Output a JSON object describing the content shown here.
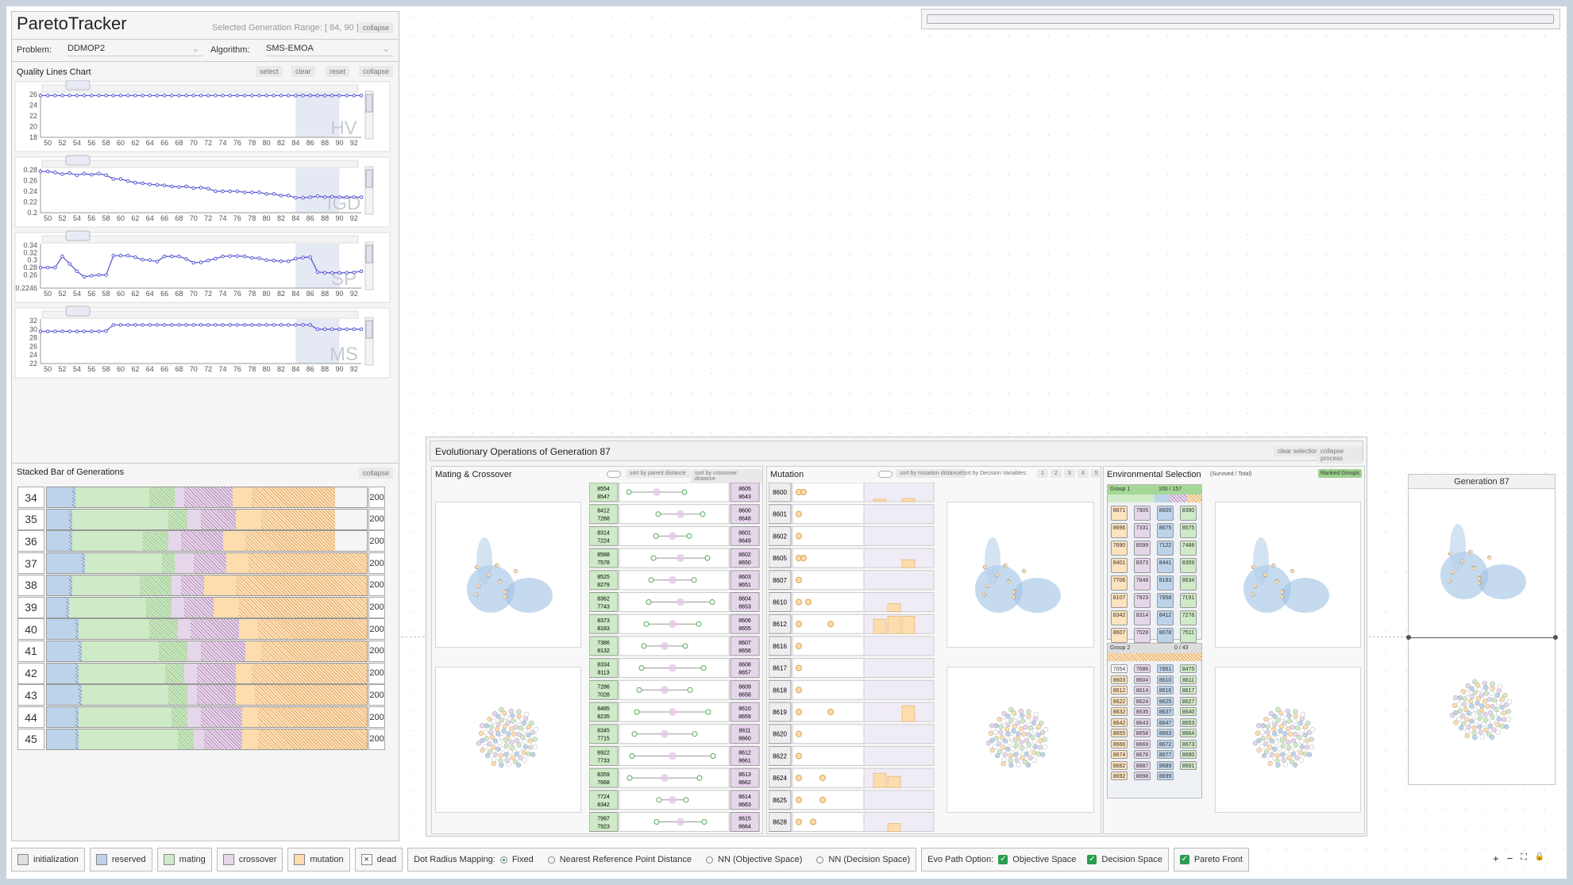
{
  "app": {
    "title": "ParetoTracker",
    "selected_range": "Selected Generation Range: [ 84, 90 ]",
    "collapse": "collapse"
  },
  "problem": {
    "label": "Problem:",
    "value": "DDMOP2"
  },
  "algorithm": {
    "label": "Algorithm:",
    "value": "SMS-EMOA"
  },
  "quality": {
    "title": "Quality Lines Chart",
    "select": "select",
    "clear": "clear",
    "reset": "reset",
    "collapse": "collapse",
    "x_ticks": [
      "50",
      "52",
      "54",
      "56",
      "58",
      "60",
      "62",
      "64",
      "66",
      "68",
      "70",
      "72",
      "74",
      "76",
      "78",
      "80",
      "82",
      "84",
      "86",
      "88",
      "90",
      "92"
    ],
    "charts": [
      {
        "name": "HV",
        "y_ticks": [
          "26",
          "24",
          "22",
          "20",
          "18"
        ]
      },
      {
        "name": "IGD",
        "y_ticks": [
          "0.28",
          "0.26",
          "0.24",
          "0.22",
          "0.2"
        ]
      },
      {
        "name": "SP",
        "y_ticks": [
          "0.34",
          "0.32",
          "0.3",
          "0.28",
          "0.26",
          "0.2246"
        ]
      },
      {
        "name": "MS",
        "y_ticks": [
          "32",
          "30",
          "28",
          "26",
          "24",
          "22"
        ]
      }
    ]
  },
  "chart_data": [
    {
      "type": "line",
      "title": "HV",
      "x": [
        49,
        50,
        51,
        52,
        53,
        54,
        55,
        56,
        57,
        58,
        59,
        60,
        61,
        62,
        63,
        64,
        65,
        66,
        67,
        68,
        69,
        70,
        71,
        72,
        73,
        74,
        75,
        76,
        77,
        78,
        79,
        80,
        81,
        82,
        83,
        84,
        85,
        86,
        87,
        88,
        89,
        90,
        91,
        92,
        93
      ],
      "y": [
        25.8,
        25.8,
        25.8,
        25.8,
        25.8,
        25.8,
        25.8,
        25.8,
        25.8,
        25.8,
        25.8,
        25.8,
        25.8,
        25.8,
        25.8,
        25.8,
        25.8,
        25.8,
        25.8,
        25.8,
        25.8,
        25.8,
        25.8,
        25.8,
        25.8,
        25.8,
        25.8,
        25.8,
        25.8,
        25.8,
        25.8,
        25.8,
        25.8,
        25.8,
        25.8,
        25.8,
        25.8,
        25.8,
        25.8,
        25.8,
        25.8,
        25.8,
        25.8,
        25.8,
        25.8
      ],
      "ylim": [
        18,
        26
      ]
    },
    {
      "type": "line",
      "title": "IGD",
      "x": [
        49,
        50,
        51,
        52,
        53,
        54,
        55,
        56,
        57,
        58,
        59,
        60,
        61,
        62,
        63,
        64,
        65,
        66,
        67,
        68,
        69,
        70,
        71,
        72,
        73,
        74,
        75,
        76,
        77,
        78,
        79,
        80,
        81,
        82,
        83,
        84,
        85,
        86,
        87,
        88,
        89,
        90,
        91,
        92,
        93
      ],
      "y": [
        0.277,
        0.277,
        0.275,
        0.272,
        0.274,
        0.27,
        0.273,
        0.271,
        0.273,
        0.27,
        0.263,
        0.263,
        0.259,
        0.256,
        0.255,
        0.253,
        0.252,
        0.251,
        0.249,
        0.248,
        0.249,
        0.246,
        0.247,
        0.245,
        0.24,
        0.24,
        0.24,
        0.24,
        0.238,
        0.238,
        0.238,
        0.235,
        0.235,
        0.232,
        0.232,
        0.228,
        0.228,
        0.229,
        0.231,
        0.229,
        0.23,
        0.229,
        0.229,
        0.229,
        0.229
      ],
      "ylim": [
        0.2,
        0.28
      ]
    },
    {
      "type": "line",
      "title": "SP",
      "x": [
        49,
        50,
        51,
        52,
        53,
        54,
        55,
        56,
        57,
        58,
        59,
        60,
        61,
        62,
        63,
        64,
        65,
        66,
        67,
        68,
        69,
        70,
        71,
        72,
        73,
        74,
        75,
        76,
        77,
        78,
        79,
        80,
        81,
        82,
        83,
        84,
        85,
        86,
        87,
        88,
        89,
        90,
        91,
        92,
        93
      ],
      "y": [
        0.28,
        0.28,
        0.28,
        0.31,
        0.29,
        0.27,
        0.255,
        0.258,
        0.26,
        0.26,
        0.312,
        0.312,
        0.312,
        0.308,
        0.301,
        0.3,
        0.296,
        0.31,
        0.31,
        0.31,
        0.303,
        0.293,
        0.294,
        0.299,
        0.304,
        0.31,
        0.311,
        0.311,
        0.31,
        0.306,
        0.305,
        0.3,
        0.299,
        0.297,
        0.297,
        0.304,
        0.307,
        0.308,
        0.268,
        0.266,
        0.266,
        0.266,
        0.266,
        0.267,
        0.27
      ],
      "ylim": [
        0.2246,
        0.34
      ]
    },
    {
      "type": "line",
      "title": "MS",
      "x": [
        49,
        50,
        51,
        52,
        53,
        54,
        55,
        56,
        57,
        58,
        59,
        60,
        61,
        62,
        63,
        64,
        65,
        66,
        67,
        68,
        69,
        70,
        71,
        72,
        73,
        74,
        75,
        76,
        77,
        78,
        79,
        80,
        81,
        82,
        83,
        84,
        85,
        86,
        87,
        88,
        89,
        90,
        91,
        92,
        93
      ],
      "y": [
        29.5,
        29.5,
        29.5,
        29.5,
        29.5,
        29.5,
        29.5,
        29.5,
        29.5,
        29.6,
        31,
        31,
        31,
        31,
        31,
        31,
        31,
        31,
        31,
        31,
        31,
        31,
        31,
        31,
        31,
        31,
        31,
        31,
        31,
        31,
        31,
        31,
        31,
        31,
        31,
        31,
        31,
        31,
        30,
        30,
        30,
        30,
        30,
        30,
        30
      ],
      "ylim": [
        22,
        32
      ]
    }
  ],
  "stacked": {
    "title": "Stacked Bar of Generations",
    "collapse": "collapse",
    "rows": [
      {
        "gen": "34",
        "total": "200",
        "segs": [
          [
            0.08,
            "b"
          ],
          [
            0.01,
            "hb"
          ],
          [
            0.23,
            "g"
          ],
          [
            0.08,
            "hg"
          ],
          [
            0.03,
            "p"
          ],
          [
            0.15,
            "hp"
          ],
          [
            0.06,
            "o"
          ],
          [
            0.26,
            "ho"
          ]
        ]
      },
      {
        "gen": "35",
        "total": "200",
        "segs": [
          [
            0.07,
            "b"
          ],
          [
            0.01,
            "hb"
          ],
          [
            0.3,
            "g"
          ],
          [
            0.06,
            "hg"
          ],
          [
            0.04,
            "p"
          ],
          [
            0.11,
            "hp"
          ],
          [
            0.08,
            "o"
          ],
          [
            0.23,
            "ho"
          ]
        ]
      },
      {
        "gen": "36",
        "total": "200",
        "segs": [
          [
            0.07,
            "b"
          ],
          [
            0.01,
            "hb"
          ],
          [
            0.22,
            "g"
          ],
          [
            0.08,
            "hg"
          ],
          [
            0.04,
            "p"
          ],
          [
            0.13,
            "hp"
          ],
          [
            0.07,
            "o"
          ],
          [
            0.28,
            "ho"
          ]
        ]
      },
      {
        "gen": "37",
        "total": "200",
        "segs": [
          [
            0.11,
            "b"
          ],
          [
            0.01,
            "hb"
          ],
          [
            0.24,
            "g"
          ],
          [
            0.04,
            "hg"
          ],
          [
            0.06,
            "p"
          ],
          [
            0.1,
            "hp"
          ],
          [
            0.07,
            "o"
          ],
          [
            0.37,
            "ho"
          ]
        ]
      },
      {
        "gen": "38",
        "total": "200",
        "segs": [
          [
            0.07,
            "b"
          ],
          [
            0.01,
            "hb"
          ],
          [
            0.21,
            "g"
          ],
          [
            0.1,
            "hg"
          ],
          [
            0.03,
            "p"
          ],
          [
            0.07,
            "hp"
          ],
          [
            0.1,
            "o"
          ],
          [
            0.41,
            "ho"
          ]
        ]
      },
      {
        "gen": "39",
        "total": "200",
        "segs": [
          [
            0.06,
            "b"
          ],
          [
            0.01,
            "hb"
          ],
          [
            0.24,
            "g"
          ],
          [
            0.08,
            "hg"
          ],
          [
            0.04,
            "p"
          ],
          [
            0.09,
            "hp"
          ],
          [
            0.08,
            "o"
          ],
          [
            0.4,
            "ho"
          ]
        ]
      },
      {
        "gen": "40",
        "total": "200",
        "segs": [
          [
            0.09,
            "b"
          ],
          [
            0.01,
            "hb"
          ],
          [
            0.22,
            "g"
          ],
          [
            0.09,
            "hg"
          ],
          [
            0.04,
            "p"
          ],
          [
            0.15,
            "hp"
          ],
          [
            0.06,
            "o"
          ],
          [
            0.34,
            "ho"
          ]
        ]
      },
      {
        "gen": "41",
        "total": "200",
        "segs": [
          [
            0.1,
            "b"
          ],
          [
            0.01,
            "hb"
          ],
          [
            0.24,
            "g"
          ],
          [
            0.09,
            "hg"
          ],
          [
            0.04,
            "p"
          ],
          [
            0.14,
            "hp"
          ],
          [
            0.05,
            "o"
          ],
          [
            0.33,
            "ho"
          ]
        ]
      },
      {
        "gen": "42",
        "total": "200",
        "segs": [
          [
            0.09,
            "b"
          ],
          [
            0.01,
            "hb"
          ],
          [
            0.27,
            "g"
          ],
          [
            0.06,
            "hg"
          ],
          [
            0.04,
            "p"
          ],
          [
            0.12,
            "hp"
          ],
          [
            0.05,
            "o"
          ],
          [
            0.36,
            "ho"
          ]
        ]
      },
      {
        "gen": "43",
        "total": "200",
        "segs": [
          [
            0.1,
            "b"
          ],
          [
            0.01,
            "hb"
          ],
          [
            0.27,
            "g"
          ],
          [
            0.06,
            "hg"
          ],
          [
            0.03,
            "p"
          ],
          [
            0.12,
            "hp"
          ],
          [
            0.06,
            "o"
          ],
          [
            0.35,
            "ho"
          ]
        ]
      },
      {
        "gen": "44",
        "total": "200",
        "segs": [
          [
            0.09,
            "b"
          ],
          [
            0.01,
            "hb"
          ],
          [
            0.29,
            "g"
          ],
          [
            0.05,
            "hg"
          ],
          [
            0.04,
            "p"
          ],
          [
            0.13,
            "hp"
          ],
          [
            0.05,
            "o"
          ],
          [
            0.34,
            "ho"
          ]
        ]
      },
      {
        "gen": "45",
        "total": "200",
        "segs": [
          [
            0.09,
            "b"
          ],
          [
            0.01,
            "hb"
          ],
          [
            0.31,
            "g"
          ],
          [
            0.05,
            "hg"
          ],
          [
            0.03,
            "p"
          ],
          [
            0.12,
            "hp"
          ],
          [
            0.05,
            "o"
          ],
          [
            0.34,
            "ho"
          ]
        ]
      }
    ]
  },
  "evo": {
    "title": "Evolutionary Operations of Generation 87",
    "clear_selection": "clear selection",
    "collapse_process": "collapse process",
    "mating": {
      "title": "Mating & Crossover",
      "sort_parent": "sort by parent distance",
      "sort_crossover": "sort by crossover distance",
      "pairs": [
        [
          "8554",
          "8547",
          "8605",
          "8643"
        ],
        [
          "8412",
          "7268",
          "8600",
          "8648"
        ],
        [
          "8314",
          "7224",
          "8601",
          "8649"
        ],
        [
          "8588",
          "7578",
          "8602",
          "8650"
        ],
        [
          "8525",
          "8279",
          "8603",
          "8651"
        ],
        [
          "8362",
          "7743",
          "8604",
          "8653"
        ],
        [
          "8373",
          "8183",
          "8606",
          "8655"
        ],
        [
          "7386",
          "8132",
          "8607",
          "8656"
        ],
        [
          "8334",
          "8113",
          "8608",
          "8657"
        ],
        [
          "7286",
          "7028",
          "8609",
          "8658"
        ],
        [
          "8485",
          "8235",
          "8610",
          "8659"
        ],
        [
          "8345",
          "7715",
          "8611",
          "8660"
        ],
        [
          "6922",
          "7733",
          "8612",
          "8661"
        ],
        [
          "8359",
          "7668",
          "8613",
          "8662"
        ],
        [
          "7724",
          "8342",
          "8614",
          "8663"
        ],
        [
          "7997",
          "7923",
          "8615",
          "8664"
        ]
      ]
    },
    "mutation": {
      "title": "Mutation",
      "sort_mut": "sort by mutation distance",
      "sort_dv": "Sort by Decision Variables:",
      "dv_buttons": [
        "1",
        "2",
        "3",
        "4",
        "5"
      ],
      "ids": [
        "8600",
        "8601",
        "8602",
        "8605",
        "8607",
        "8610",
        "8612",
        "8616",
        "8617",
        "8618",
        "8619",
        "8620",
        "8622",
        "8624",
        "8625",
        "8628"
      ]
    },
    "env": {
      "title": "Environmental Selection",
      "subtitle": "(Survived / Total)",
      "ranked": "Ranked Groups",
      "group1": {
        "name": "Group 1",
        "count": "100 / 157",
        "ids": [
          "8671",
          "7905",
          "8605",
          "8390",
          "8696",
          "7331",
          "8675",
          "8575",
          "7690",
          "8099",
          "7122",
          "7488",
          "8401",
          "8373",
          "8441",
          "8359",
          "7706",
          "7848",
          "8183",
          "8634",
          "8107",
          "7923",
          "7858",
          "7191",
          "8342",
          "8314",
          "8412",
          "7278",
          "8607",
          "7028",
          "8078",
          "7511"
        ]
      },
      "group2": {
        "name": "Group 2",
        "count": "0 / 43",
        "ids": [
          "7054",
          "7686",
          "7861",
          "8475",
          "8603",
          "8604",
          "8610",
          "8611",
          "8612",
          "8614",
          "8616",
          "8617",
          "8622",
          "8624",
          "8625",
          "8627",
          "8632",
          "8635",
          "8637",
          "8640",
          "8642",
          "8643",
          "8647",
          "8653",
          "8655",
          "8658",
          "8663",
          "8664",
          "8666",
          "8669",
          "8672",
          "8673",
          "8674",
          "8676",
          "8677",
          "8680",
          "8682",
          "8687",
          "8689",
          "8691",
          "8692",
          "8698",
          "8699"
        ]
      }
    }
  },
  "gen_card": {
    "title": "Generation 87"
  },
  "legend": {
    "items": [
      "initialization",
      "reserved",
      "mating",
      "crossover",
      "mutation",
      "dead"
    ],
    "dot_radius": "Dot Radius Mapping:",
    "radius_opts": [
      "Fixed",
      "Nearest Reference Point Distance",
      "NN (Objective Space)",
      "NN (Decision Space)"
    ],
    "evo_path": "Evo Path Option:",
    "path_opts": [
      "Objective Space",
      "Decision Space"
    ],
    "pareto": "Pareto Front"
  },
  "colors": {
    "reserved": "#bcd3ea",
    "mating": "#cfeac6",
    "crossover": "#e6d6ea",
    "mutation": "#fddcae",
    "line": "#5b5bd6"
  },
  "zoom_icons": [
    "plus-icon",
    "minus-icon",
    "fullscreen-icon",
    "lock-icon"
  ]
}
